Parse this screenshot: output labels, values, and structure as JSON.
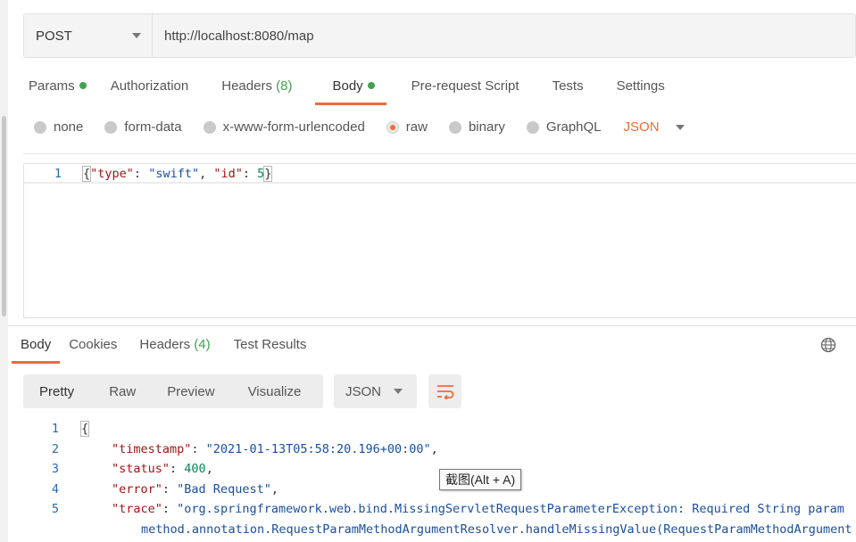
{
  "request": {
    "method": "POST",
    "url": "http://localhost:8080/map",
    "tabs": [
      {
        "label": "Params"
      },
      {
        "label": "Authorization"
      },
      {
        "label": "Headers",
        "count": "(8)"
      },
      {
        "label": "Body"
      },
      {
        "label": "Pre-request Script"
      },
      {
        "label": "Tests"
      },
      {
        "label": "Settings"
      }
    ],
    "body_types": [
      "none",
      "form-data",
      "x-www-form-urlencoded",
      "raw",
      "binary",
      "GraphQL"
    ],
    "body_format": "JSON",
    "editor": {
      "line_numbers": [
        "1"
      ],
      "tokens": {
        "brace_open": "{",
        "key_type": "\"type\"",
        "colon_1": ": ",
        "val_type": "\"swift\"",
        "comma_1": ", ",
        "key_id": "\"id\"",
        "colon_2": ": ",
        "val_id": "5",
        "brace_close": "}"
      }
    }
  },
  "response": {
    "tabs": [
      {
        "label": "Body"
      },
      {
        "label": "Cookies"
      },
      {
        "label": "Headers",
        "count": "(4)"
      },
      {
        "label": "Test Results"
      }
    ],
    "view_modes": [
      "Pretty",
      "Raw",
      "Preview",
      "Visualize"
    ],
    "format": "JSON",
    "line_numbers": [
      "1",
      "2",
      "3",
      "4",
      "5"
    ],
    "lines": {
      "l1": "{",
      "k2": "\"timestamp\"",
      "v2": "\"2021-01-13T05:58:20.196+00:00\"",
      "k3": "\"status\"",
      "v3": "400",
      "k4": "\"error\"",
      "v4": "\"Bad Request\"",
      "k5": "\"trace\"",
      "v5": "\"org.springframework.web.bind.MissingServletRequestParameterException: Required String param",
      "l5b": "method.annotation.RequestParamMethodArgumentResolver.handleMissingValue(RequestParamMethodArgument"
    }
  },
  "tooltip": "截图(Alt + A)",
  "colors": {
    "accent": "#ef6c36",
    "success": "#3fa34d"
  }
}
